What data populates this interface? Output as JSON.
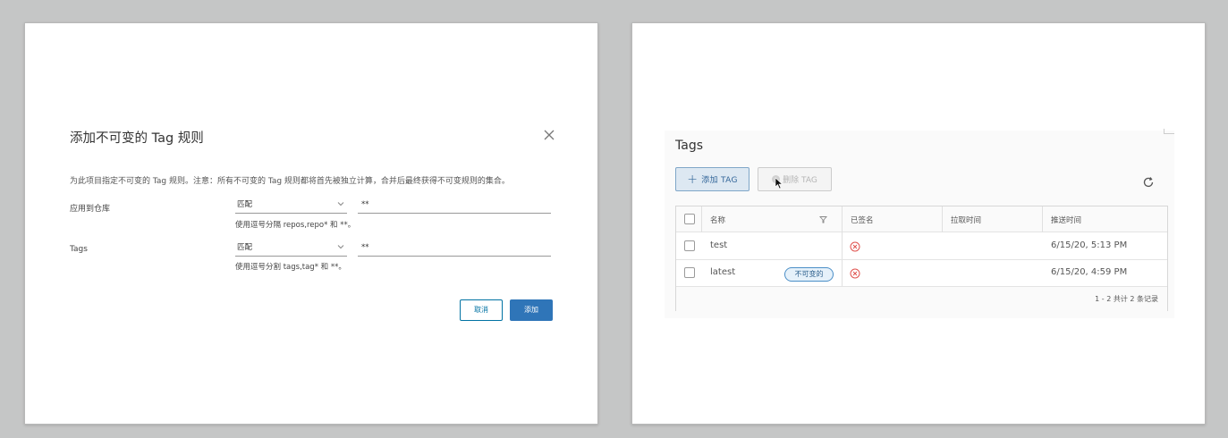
{
  "dialog": {
    "title": "添加不可变的 Tag 规则",
    "description": "为此项目指定不可变的 Tag 规则。注意：所有不可变的 Tag 规则都将首先被独立计算，合并后最终获得不可变规则的集合。",
    "repo_row": {
      "label": "应用到仓库",
      "select_value": "匹配",
      "pattern_value": "**",
      "hint": "使用逗号分隔 repos,repo* 和 **。"
    },
    "tags_row": {
      "label": "Tags",
      "select_value": "匹配",
      "pattern_value": "**",
      "hint": "使用逗号分割 tags,tag* 和 **。"
    },
    "cancel_label": "取消",
    "add_label": "添加"
  },
  "tags_panel": {
    "title": "Tags",
    "add_tag_label": "添加 TAG",
    "delete_tag_label": "删除 TAG",
    "columns": [
      "名称",
      "已签名",
      "拉取时间",
      "推送时间"
    ],
    "rows": [
      {
        "name": "test",
        "badge": "",
        "signed": "no",
        "pull_time": "",
        "push_time": "6/15/20, 5:13 PM"
      },
      {
        "name": "latest",
        "badge": "不可变的",
        "signed": "no",
        "pull_time": "",
        "push_time": "6/15/20, 4:59 PM"
      }
    ],
    "footer": "1 - 2 共计 2 条记录"
  },
  "colors": {
    "primary": "#2f75b8",
    "link": "#0072a3",
    "error": "#e0524e",
    "badge_border": "#4a8ec7"
  },
  "icons": [
    "close-icon",
    "chevron-down-icon",
    "plus-icon",
    "refresh-icon",
    "filter-icon",
    "error-circle-icon",
    "mouse-cursor-icon"
  ]
}
